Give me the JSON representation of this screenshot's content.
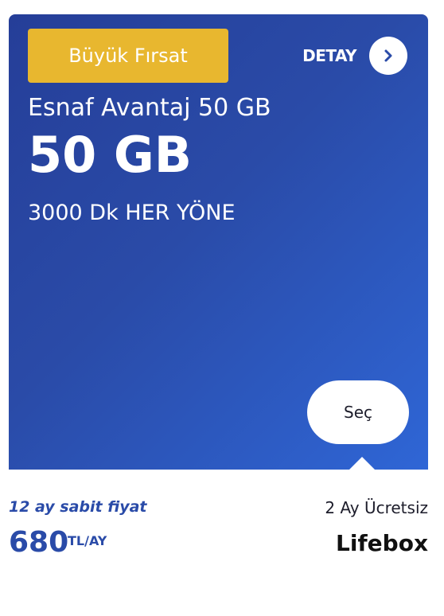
{
  "badge": {
    "label": "Büyük Fırsat"
  },
  "detay": {
    "label": "DETAY",
    "icon": "chevron-right-icon"
  },
  "plan": {
    "name": "Esnaf Avantaj 50 GB",
    "data": "50 GB",
    "minutes": "3000 Dk HER YÖNE"
  },
  "actions": {
    "select_label": "Seç"
  },
  "pricing": {
    "fixed_label": "12 ay sabit fiyat",
    "amount": "680",
    "unit": "TL/AY"
  },
  "extra": {
    "free_months": "2 Ay Ücretsiz",
    "product": "Lifebox"
  },
  "colors": {
    "hero_start": "#253e98",
    "hero_end": "#2f66d6",
    "badge": "#e8b72f",
    "price_text": "#2a4ba8"
  }
}
